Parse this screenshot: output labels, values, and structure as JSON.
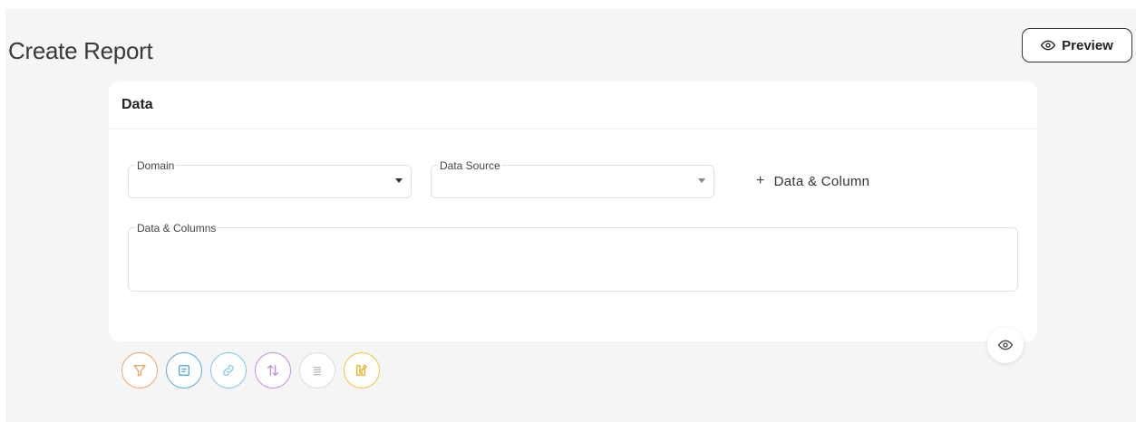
{
  "header": {
    "title": "Create Report",
    "preview_label": "Preview"
  },
  "card": {
    "title": "Data",
    "domain": {
      "label": "Domain",
      "value": ""
    },
    "data_source": {
      "label": "Data Source",
      "value": ""
    },
    "add_data_column_label": "Data & Column",
    "data_columns": {
      "label": "Data & Columns",
      "value": ""
    }
  },
  "toolbar": {
    "items": [
      {
        "icon": "filter-icon",
        "color": "#f0a46a"
      },
      {
        "icon": "form-icon",
        "color": "#5aa7e0"
      },
      {
        "icon": "link-icon",
        "color": "#7cc7ea"
      },
      {
        "icon": "sort-icon",
        "color": "#c38de0"
      },
      {
        "icon": "list-icon",
        "color": "#cfcfcf"
      },
      {
        "icon": "columns-settings-icon",
        "color": "#f2c33a"
      }
    ]
  },
  "colors": {
    "page_bg": "#f5f5f5",
    "card_bg": "#ffffff",
    "border": "#e0e0e0"
  }
}
